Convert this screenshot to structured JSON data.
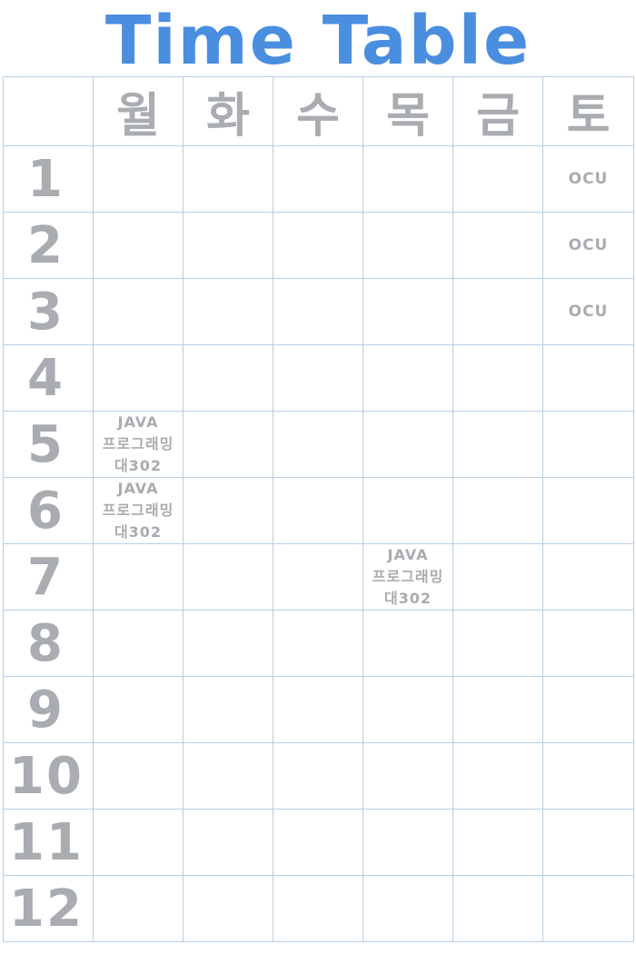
{
  "title": "Time Table",
  "days": [
    "월",
    "화",
    "수",
    "목",
    "금",
    "토"
  ],
  "periods": [
    "1",
    "2",
    "3",
    "4",
    "5",
    "6",
    "7",
    "8",
    "9",
    "10",
    "11",
    "12"
  ],
  "classes": {
    "java": {
      "name": "JAVA",
      "subject": "프로그래밍",
      "room": "대302"
    },
    "ocu": "OCU"
  }
}
